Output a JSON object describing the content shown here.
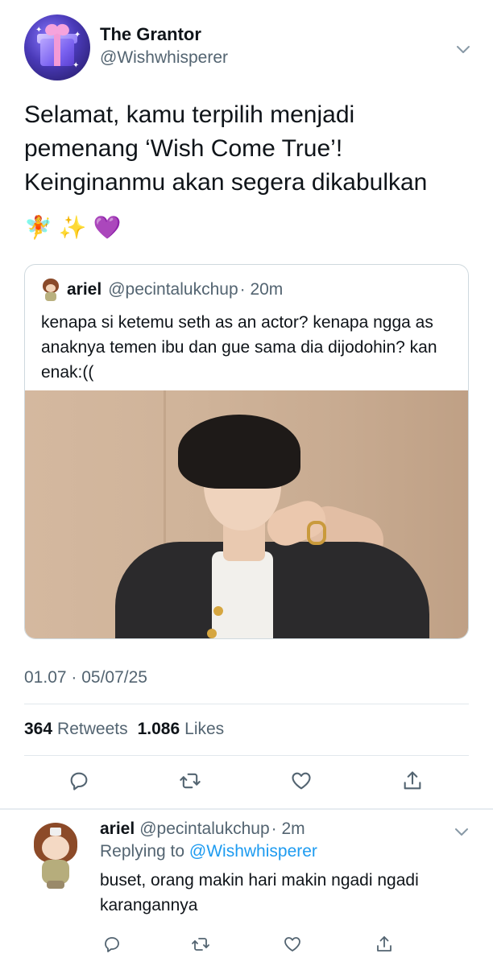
{
  "tweet": {
    "author": {
      "display_name": "The Grantor",
      "handle": "@Wishwhisperer"
    },
    "text": "Selamat, kamu terpilih menjadi pemenang ‘Wish Come True’! Keinginanmu akan segera dikabulkan",
    "emojis": [
      "🧚",
      "✨",
      "💜"
    ],
    "quote": {
      "name": "ariel",
      "handle": "@pecintalukchup",
      "time": "· 20m",
      "text": "kenapa si ketemu seth as an actor? kenapa ngga as anaknya temen ibu dan gue sama dia dijodohin? kan enak:(("
    },
    "timestamp": "01.07 · 05/07/25",
    "stats": {
      "retweets_count": "364",
      "retweets_label": "Retweets",
      "likes_count": "1.086",
      "likes_label": "Likes"
    },
    "actions": [
      "reply-icon",
      "retweet-icon",
      "like-icon",
      "share-icon"
    ]
  },
  "reply": {
    "name": "ariel",
    "handle": "@pecintalukchup",
    "time": "· 2m",
    "replying_prefix": "Replying to",
    "replying_handle": "@Wishwhisperer",
    "text": "buset, orang makin hari makin ngadi ngadi karangannya"
  },
  "colors": {
    "text": "#0f1419",
    "secondary": "#536471",
    "link": "#1d9bf0",
    "border": "#cfd9de"
  }
}
